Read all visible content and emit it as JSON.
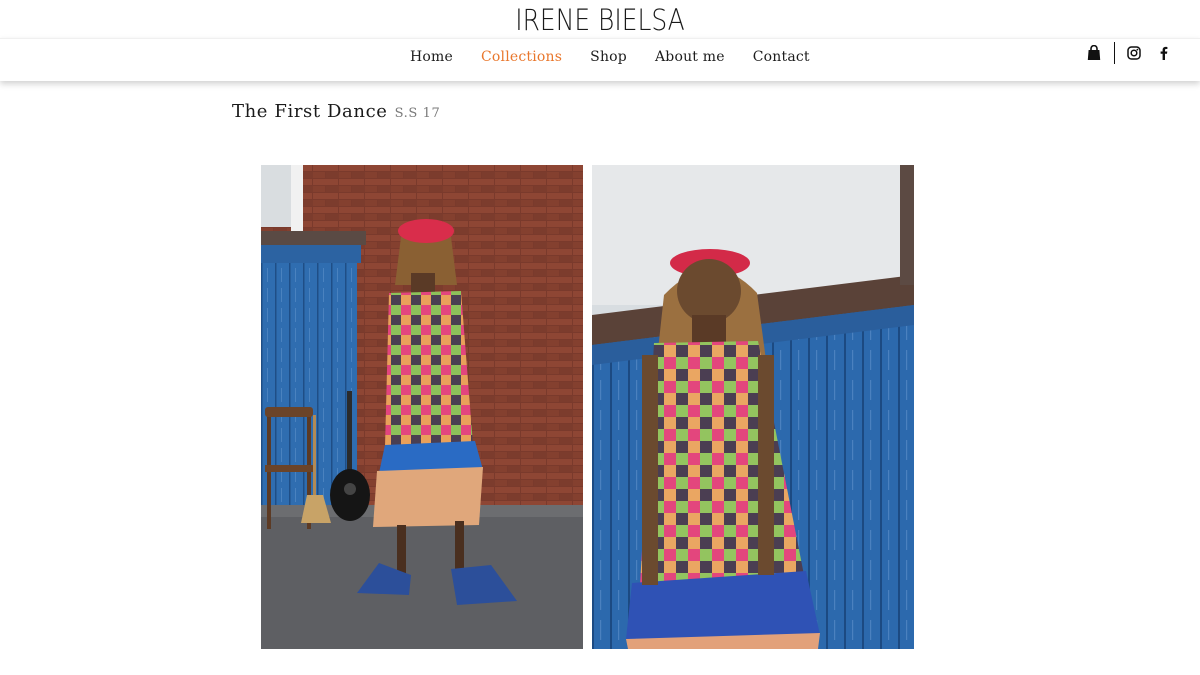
{
  "header": {
    "logo": "IRENE BIELSA",
    "nav": [
      {
        "label": "Home",
        "active": false
      },
      {
        "label": "Collections",
        "active": true
      },
      {
        "label": "Shop",
        "active": false
      },
      {
        "label": "About me",
        "active": false
      },
      {
        "label": "Contact",
        "active": false
      }
    ],
    "icons": [
      "shopping-bag-icon",
      "instagram-icon",
      "facebook-icon"
    ],
    "accent_color": "#e9772c"
  },
  "main": {
    "collection_title": "The First Dance",
    "season": "S.S 17"
  }
}
